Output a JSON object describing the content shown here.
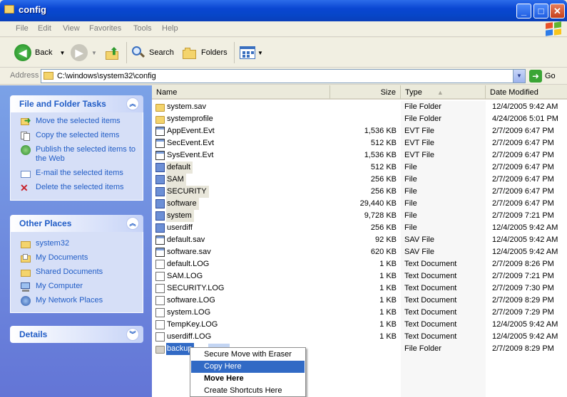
{
  "window": {
    "title": "config"
  },
  "menu": [
    "File",
    "Edit",
    "View",
    "Favorites",
    "Tools",
    "Help"
  ],
  "toolbar": {
    "back": "Back",
    "search": "Search",
    "folders": "Folders"
  },
  "address": {
    "label": "Address",
    "path": "C:\\windows\\system32\\config",
    "go": "Go"
  },
  "tasks": {
    "title": "File and Folder Tasks",
    "items": [
      "Move the selected items",
      "Copy the selected items",
      "Publish the selected items to the Web",
      "E-mail the selected items",
      "Delete the selected items"
    ]
  },
  "places": {
    "title": "Other Places",
    "items": [
      "system32",
      "My Documents",
      "Shared Documents",
      "My Computer",
      "My Network Places"
    ]
  },
  "details": {
    "title": "Details"
  },
  "columns": {
    "name": "Name",
    "size": "Size",
    "type": "Type",
    "date": "Date Modified"
  },
  "files": [
    {
      "name": "system.sav",
      "size": "",
      "type": "File Folder",
      "date": "12/4/2005 9:42 AM"
    },
    {
      "name": "systemprofile",
      "size": "",
      "type": "File Folder",
      "date": "4/24/2006 5:01 PM"
    },
    {
      "name": "AppEvent.Evt",
      "size": "1,536 KB",
      "type": "EVT File",
      "date": "2/7/2009 6:47 PM"
    },
    {
      "name": "SecEvent.Evt",
      "size": "512 KB",
      "type": "EVT File",
      "date": "2/7/2009 6:47 PM"
    },
    {
      "name": "SysEvent.Evt",
      "size": "1,536 KB",
      "type": "EVT File",
      "date": "2/7/2009 6:47 PM"
    },
    {
      "name": "default",
      "size": "512 KB",
      "type": "File",
      "date": "2/7/2009 6:47 PM"
    },
    {
      "name": "SAM",
      "size": "256 KB",
      "type": "File",
      "date": "2/7/2009 6:47 PM"
    },
    {
      "name": "SECURITY",
      "size": "256 KB",
      "type": "File",
      "date": "2/7/2009 6:47 PM"
    },
    {
      "name": "software",
      "size": "29,440 KB",
      "type": "File",
      "date": "2/7/2009 6:47 PM"
    },
    {
      "name": "system",
      "size": "9,728 KB",
      "type": "File",
      "date": "2/7/2009 7:21 PM"
    },
    {
      "name": "userdiff",
      "size": "256 KB",
      "type": "File",
      "date": "12/4/2005 9:42 AM"
    },
    {
      "name": "default.sav",
      "size": "92 KB",
      "type": "SAV File",
      "date": "12/4/2005 9:42 AM"
    },
    {
      "name": "software.sav",
      "size": "620 KB",
      "type": "SAV File",
      "date": "12/4/2005 9:42 AM"
    },
    {
      "name": "default.LOG",
      "size": "1 KB",
      "type": "Text Document",
      "date": "2/7/2009 8:26 PM"
    },
    {
      "name": "SAM.LOG",
      "size": "1 KB",
      "type": "Text Document",
      "date": "2/7/2009 7:21 PM"
    },
    {
      "name": "SECURITY.LOG",
      "size": "1 KB",
      "type": "Text Document",
      "date": "2/7/2009 7:30 PM"
    },
    {
      "name": "software.LOG",
      "size": "1 KB",
      "type": "Text Document",
      "date": "2/7/2009 8:29 PM"
    },
    {
      "name": "system.LOG",
      "size": "1 KB",
      "type": "Text Document",
      "date": "2/7/2009 7:29 PM"
    },
    {
      "name": "TempKey.LOG",
      "size": "1 KB",
      "type": "Text Document",
      "date": "12/4/2005 9:42 AM"
    },
    {
      "name": "userdiff.LOG",
      "size": "1 KB",
      "type": "Text Document",
      "date": "12/4/2005 9:42 AM"
    },
    {
      "name": "backup",
      "size": "",
      "type": "File Folder",
      "date": "2/7/2009 8:29 PM"
    }
  ],
  "context_menu": [
    "Secure Move with Eraser",
    "Copy Here",
    "Move Here",
    "Create Shortcuts Here"
  ]
}
